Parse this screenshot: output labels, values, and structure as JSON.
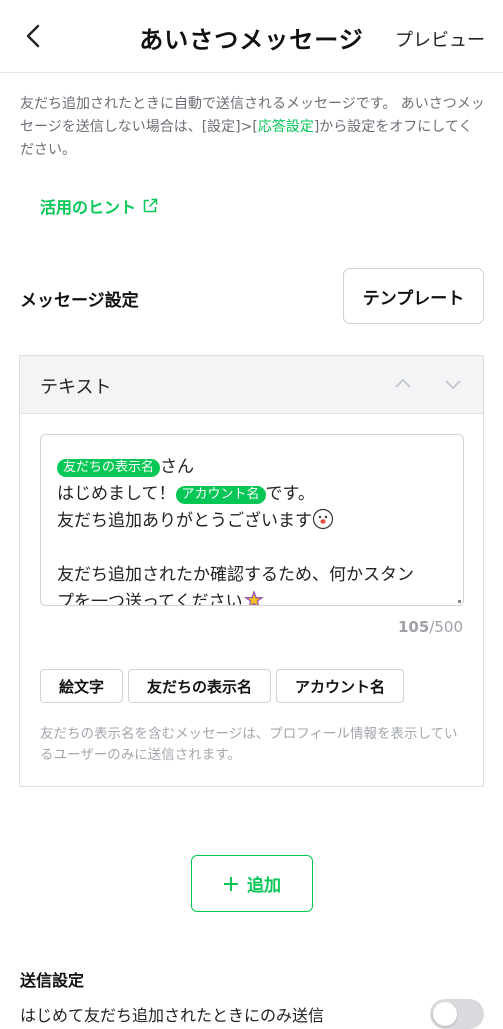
{
  "header": {
    "back_icon": "chevron-left-icon",
    "title": "あいさつメッセージ",
    "preview_label": "プレビュー"
  },
  "description": {
    "part1": "友だち追加されたときに自動で送信されるメッセージです。 あいさつメッセージを送信しない場合は、[設定]>[",
    "link": "応答設定",
    "part2": "]から設定をオフにしてください。"
  },
  "hint": {
    "label": "活用のヒント",
    "icon": "external-link-icon"
  },
  "message_settings": {
    "label": "メッセージ設定",
    "template_button": "テンプレート"
  },
  "card": {
    "type_label": "テキスト",
    "message": {
      "tag_friend_name": "友だちの表示名",
      "line1_suffix": "さん",
      "line2_prefix": "はじめまして！",
      "tag_account_name": "アカウント名",
      "line2_suffix": "です。",
      "line3": "友だち追加ありがとうございます",
      "line4": "友だち追加されたか確認するため、何かスタン",
      "line5": "プを一つ送ってください"
    },
    "counter_current": "105",
    "counter_max": "/500",
    "chips": [
      "絵文字",
      "友だちの表示名",
      "アカウント名"
    ],
    "note": "友だちの表示名を含むメッセージは、プロフィール情報を表示しているユーザーのみに送信されます。"
  },
  "add_button": {
    "icon": "plus-icon",
    "label": "追加"
  },
  "send_settings": {
    "title": "送信設定",
    "option_label": "はじめて友だち追加されたときにのみ送信",
    "option_on": false
  },
  "colors": {
    "accent": "#06c755",
    "muted": "#6b6f75"
  }
}
